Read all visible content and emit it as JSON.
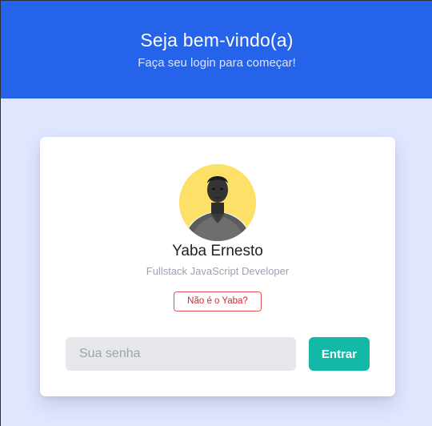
{
  "header": {
    "title": "Seja bem-vindo(a)",
    "subtitle": "Faça seu login para começar!"
  },
  "profile": {
    "name": "Yaba Ernesto",
    "role": "Fullstack JavaScript Developer",
    "not_you_label": "Não é o Yaba?",
    "avatar_icon": "profile-photo"
  },
  "login": {
    "password_placeholder": "Sua senha",
    "password_value": "",
    "submit_label": "Entrar"
  },
  "colors": {
    "header_bg": "#2563eb",
    "page_bg": "#e0e6fe",
    "avatar_bg": "#fde068",
    "danger": "#dc2626",
    "submit_bg": "#14b8a6"
  }
}
